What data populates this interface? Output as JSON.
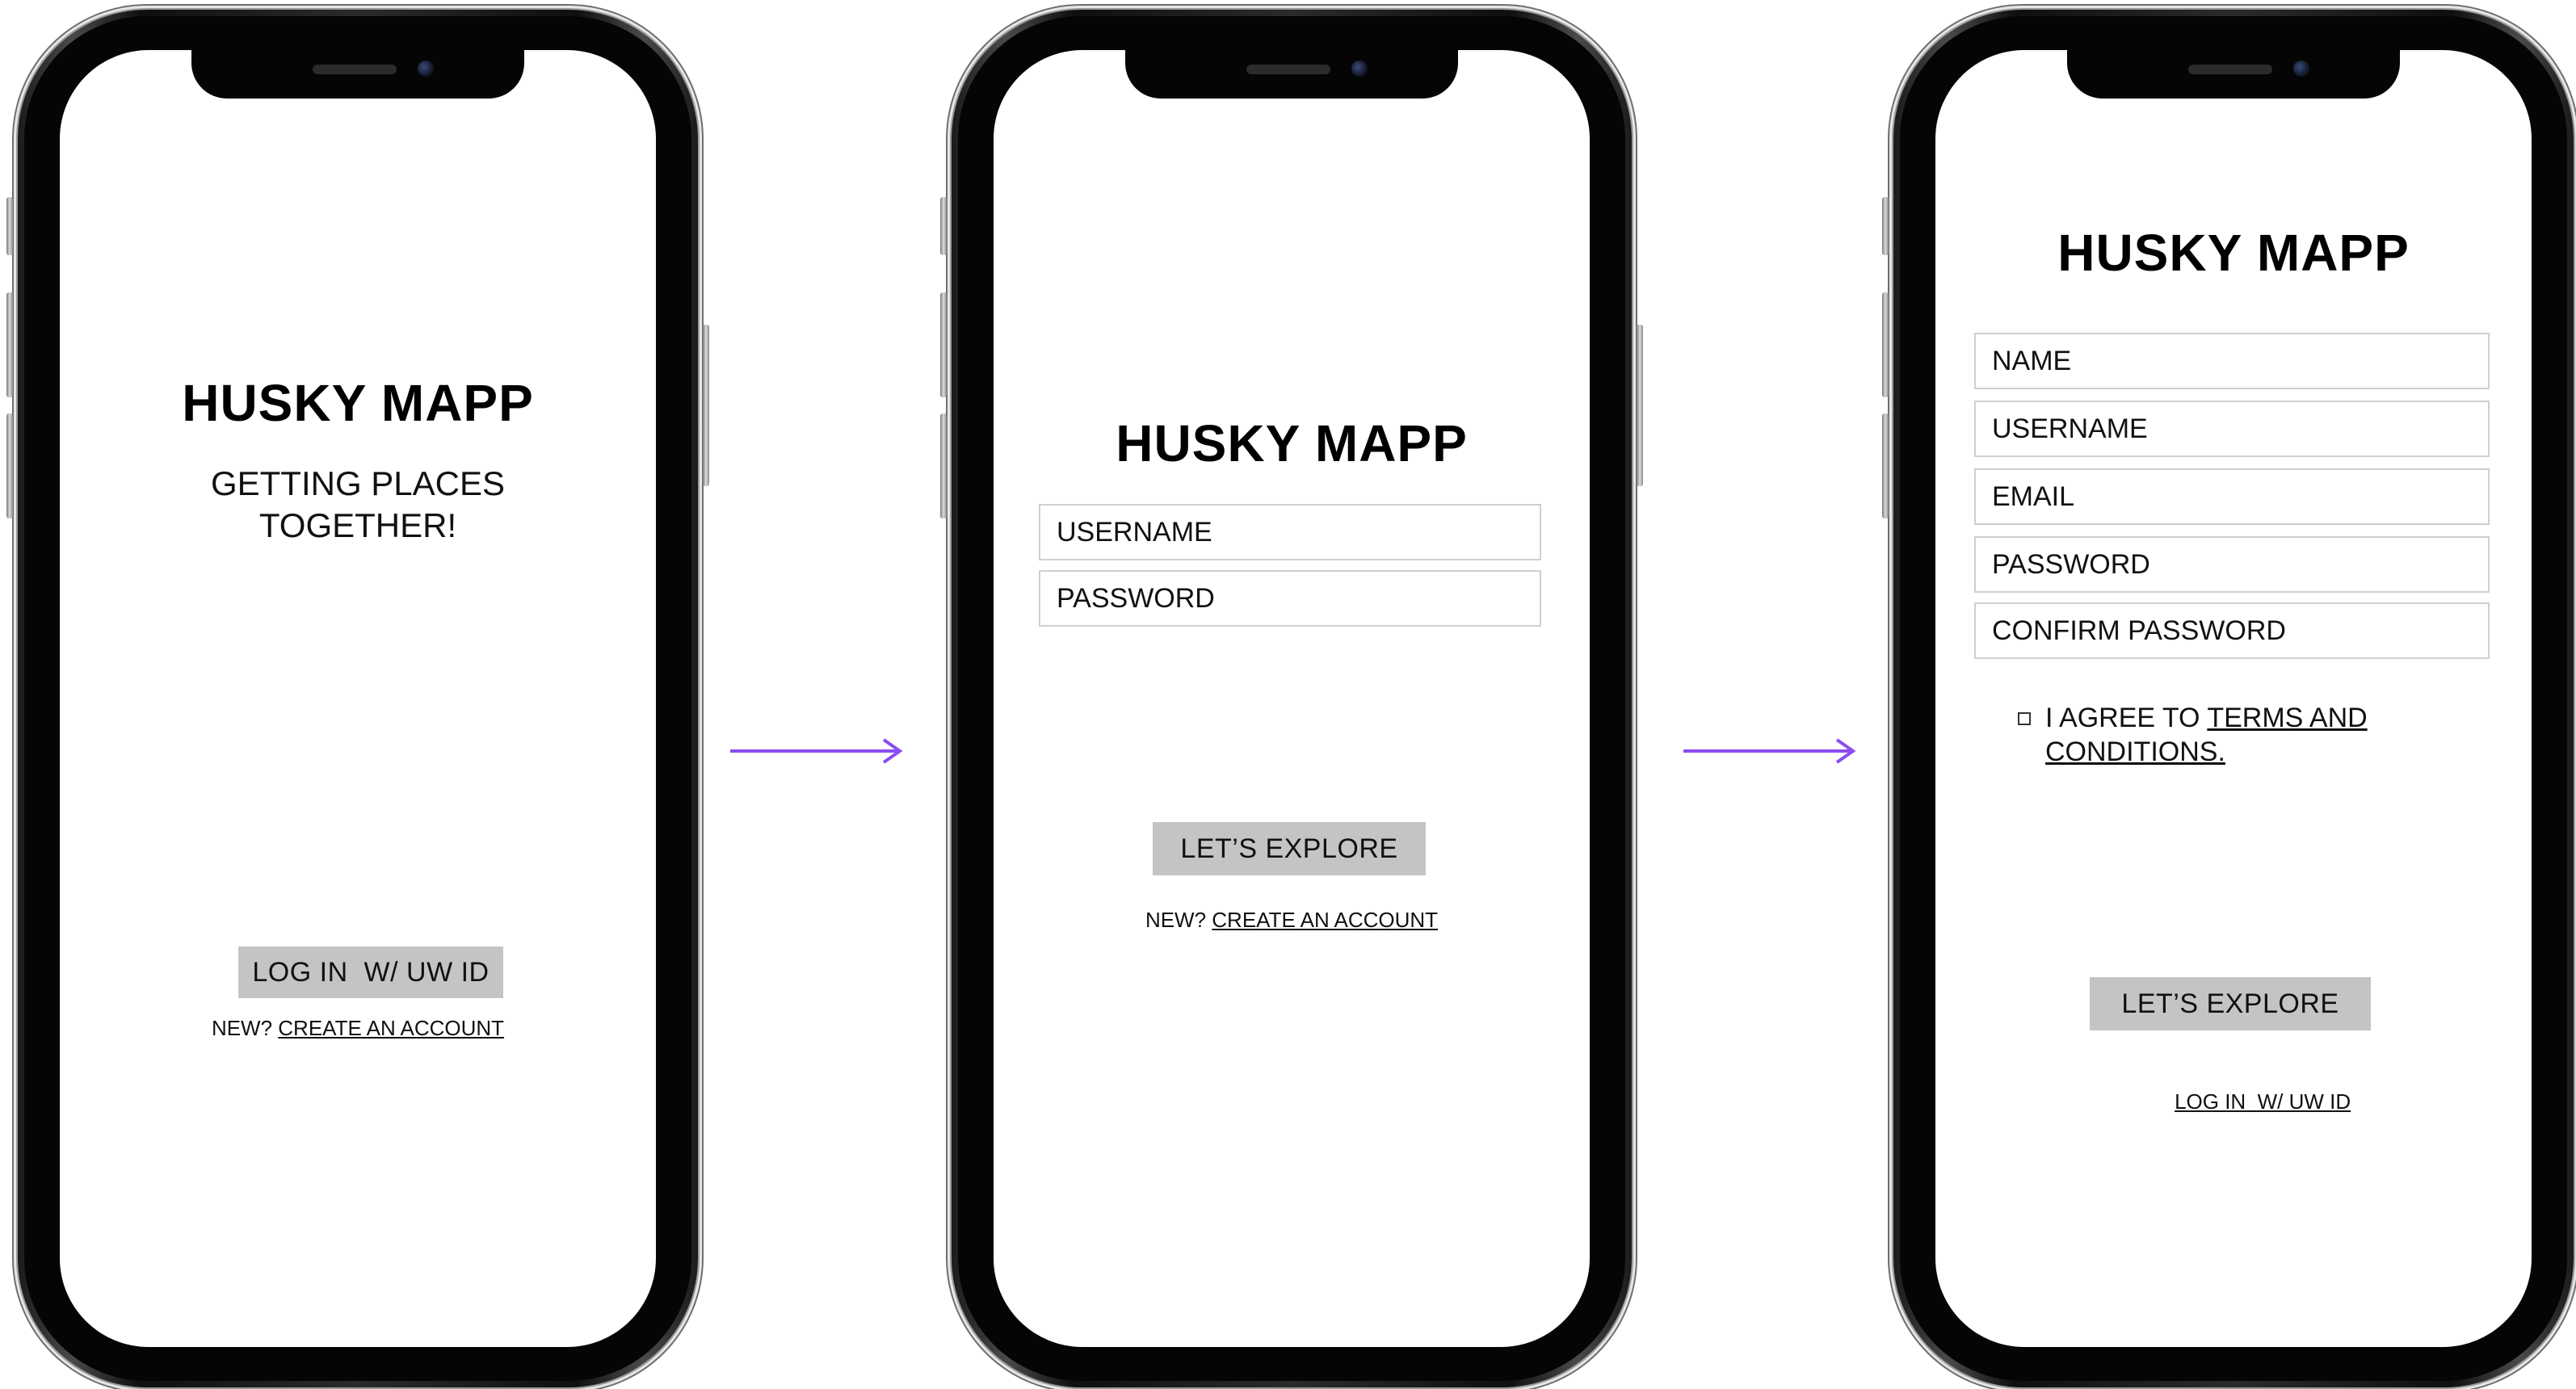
{
  "app_title": "HUSKY MAPP",
  "screen1": {
    "tagline_line1": "GETTING PLACES",
    "tagline_line2": "TOGETHER!",
    "login_button": "LOG IN  W/ UW ID",
    "new_prefix": "NEW? ",
    "create_account_link": "CREATE AN ACCOUNT"
  },
  "screen2": {
    "username_placeholder": "USERNAME",
    "password_placeholder": "PASSWORD",
    "explore_button": "LET’S EXPLORE",
    "new_prefix": "NEW? ",
    "create_account_link": "CREATE AN ACCOUNT"
  },
  "screen3": {
    "fields": [
      "NAME",
      "USERNAME",
      "EMAIL",
      "PASSWORD",
      "CONFIRM PASSWORD"
    ],
    "agree_prefix": "I AGREE TO ",
    "terms_link_line1": "TERMS AND",
    "terms_link_line2": "CONDITIONS.",
    "explore_button": "LET’S EXPLORE",
    "login_link": "LOG IN  W/ UW ID"
  },
  "colors": {
    "arrow": "#8a4cf0",
    "button_bg": "#c4c4c4",
    "field_border": "#cfcfcf"
  },
  "icons": {
    "arrow": "right-arrow-icon",
    "checkbox": "checkbox-icon",
    "camera": "camera-icon",
    "speaker": "speaker-icon"
  }
}
